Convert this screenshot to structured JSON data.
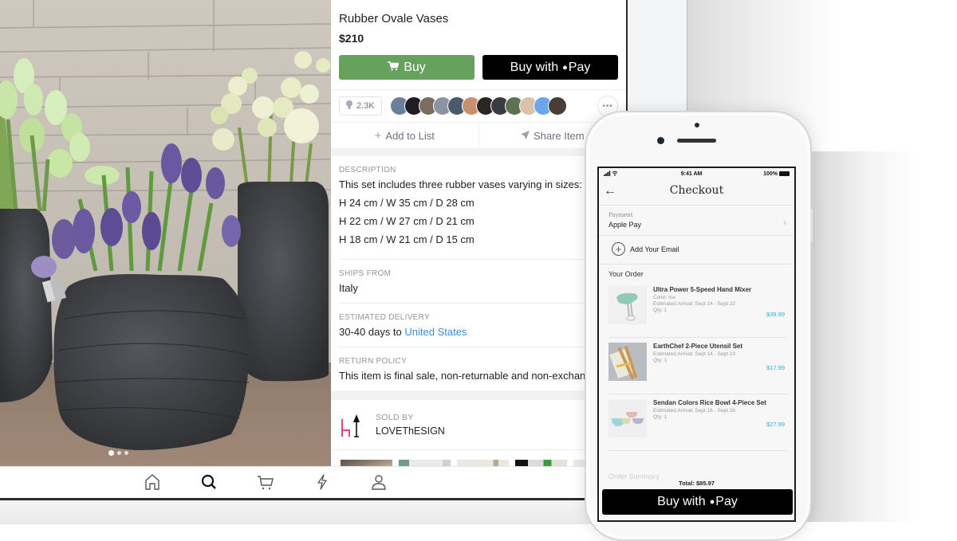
{
  "product": {
    "title": "Rubber Ovale Vases",
    "price": "$210",
    "buy_label": "Buy",
    "apple_pay_prefix": "Buy with",
    "apple_glyph": "",
    "apple_pay_suffix": "Pay",
    "like_count": "2.3K",
    "more_label": "•••",
    "add_to_list_label": "Add to List",
    "share_label": "Share Item",
    "photo_dots": {
      "count": 3,
      "active": 1
    }
  },
  "details": [
    {
      "label": "DESCRIPTION",
      "lines": [
        "This set includes three rubber vases varying in sizes:",
        "H 24 cm / W 35 cm / D 28 cm",
        "H 22 cm / W 27 cm / D 21 cm",
        "H 18 cm / W 21 cm / D 15 cm"
      ]
    },
    {
      "label": "SHIPS FROM",
      "lines": [
        "Italy"
      ]
    },
    {
      "label": "ESTIMATED DELIVERY",
      "text": "30-40 days to",
      "link": "United States"
    },
    {
      "label": "RETURN POLICY",
      "lines": [
        "This item is final sale, non-returnable and non-exchang"
      ]
    }
  ],
  "seller": {
    "label": "SOLD BY",
    "name": "LOVEThESIGN"
  },
  "tabbar": [
    {
      "name": "home"
    },
    {
      "name": "search"
    },
    {
      "name": "cart"
    },
    {
      "name": "activity"
    },
    {
      "name": "profile"
    }
  ],
  "colors": {
    "buy_green": "#67a15e",
    "link_blue": "#3b8fd8",
    "price_teal": "#2ab3c4"
  },
  "phone": {
    "status": {
      "time": "9:41 AM",
      "battery": "100%"
    },
    "title": "Checkout",
    "payment_label": "Payment",
    "payment_value": "Apple Pay",
    "add_email_label": "Add Your Email",
    "your_order_label": "Your Order",
    "items": [
      {
        "name": "Ultra Power 5-Speed Hand Mixer",
        "color": "Color: Ice",
        "arrival": "Estimated Arrival: Sept 14 - Sept 23",
        "qty": "Qty: 1",
        "price": "$39.99"
      },
      {
        "name": "EarthChef 2-Piece Utensil Set",
        "arrival": "Estimated Arrival: Sept 14 - Sept 23",
        "qty": "Qty: 1",
        "price": "$17.99"
      },
      {
        "name": "Sendan Colors Rice Bowl 4-Piece Set",
        "arrival": "Estimated Arrival: Sept 16 - Sept 26",
        "qty": "Qty: 1",
        "price": "$27.99"
      }
    ],
    "order_summary_label": "Order Summary",
    "total": "Total: $85.97",
    "buy_prefix": "Buy with",
    "buy_suffix": "Pay"
  }
}
